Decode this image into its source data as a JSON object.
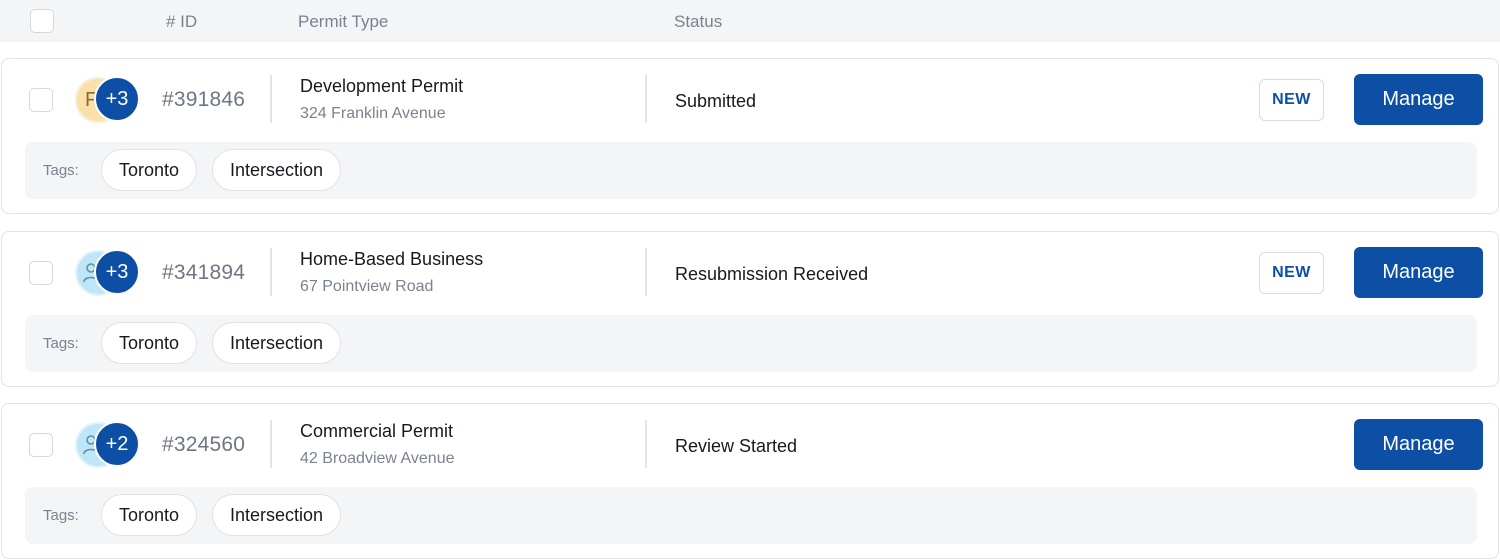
{
  "header": {
    "columns": [
      "# ID",
      "Permit Type",
      "Status"
    ]
  },
  "tags_label": "Tags:",
  "permits": [
    {
      "avatar_initial": "F",
      "avatar_color": "#fbe1a8",
      "extra_count": "+3",
      "id": "#391846",
      "type": "Development Permit",
      "address": "324 Franklin Avenue",
      "status": "Submitted",
      "badge": "NEW",
      "action": "Manage",
      "tags": [
        "Toronto",
        "Intersection"
      ]
    },
    {
      "avatar_initial": "",
      "avatar_color": "#bfe6f7",
      "extra_count": "+3",
      "id": "#341894",
      "type": "Home-Based Business",
      "address": "67 Pointview Road",
      "status": "Resubmission Received",
      "badge": "NEW",
      "action": "Manage",
      "tags": [
        "Toronto",
        "Intersection"
      ]
    },
    {
      "avatar_initial": "",
      "avatar_color": "#bfe6f7",
      "extra_count": "+2",
      "id": "#324560",
      "type": "Commercial Permit",
      "address": "42 Broadview Avenue",
      "status": "Review Started",
      "badge": "",
      "action": "Manage",
      "tags": [
        "Toronto",
        "Intersection"
      ]
    }
  ],
  "colors": {
    "accent": "#0e4fa6",
    "header_bg": "#f4f5f7"
  }
}
